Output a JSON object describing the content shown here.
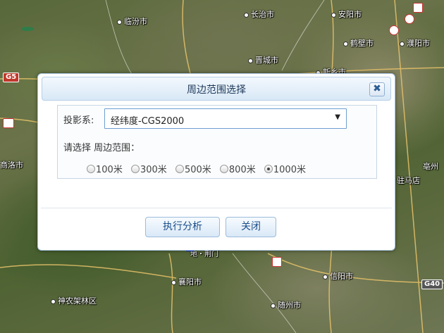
{
  "map": {
    "cities": [
      {
        "id": "linfen",
        "label": "临汾市"
      },
      {
        "id": "changzhi",
        "label": "长治市"
      },
      {
        "id": "anyang",
        "label": "安阳市"
      },
      {
        "id": "hebi",
        "label": "鹤壁市"
      },
      {
        "id": "puyang",
        "label": "濮阳市"
      },
      {
        "id": "jincheng",
        "label": "晋城市"
      },
      {
        "id": "xinxiang",
        "label": "新乡市"
      },
      {
        "id": "shangluo",
        "label": "商洛市"
      },
      {
        "id": "bozhou",
        "label": "亳州"
      },
      {
        "id": "xiangyang",
        "label": "襄阳市"
      },
      {
        "id": "xinyang",
        "label": "信阳市"
      },
      {
        "id": "suizhou",
        "label": "随州市"
      },
      {
        "id": "shennongjia",
        "label": "神农架林区"
      },
      {
        "id": "zhumadian",
        "label": "驻马店"
      },
      {
        "id": "nanyang",
        "label": "地・荆门"
      }
    ],
    "road_shields": [
      {
        "id": "g5",
        "label": "G5"
      },
      {
        "id": "g40",
        "label": "G40"
      }
    ]
  },
  "dialog": {
    "title": "周边范围选择",
    "close_icon": "close-icon",
    "projection_label": "投影系:",
    "projection_value": "经纬度-CGS2000",
    "range_label": "请选择 周边范围：",
    "radius_options": [
      {
        "label": "100米",
        "selected": false
      },
      {
        "label": "300米",
        "selected": false
      },
      {
        "label": "500米",
        "selected": false
      },
      {
        "label": "800米",
        "selected": false
      },
      {
        "label": "1000米",
        "selected": true
      }
    ],
    "analyze_button": "执行分析",
    "close_button": "关闭"
  }
}
